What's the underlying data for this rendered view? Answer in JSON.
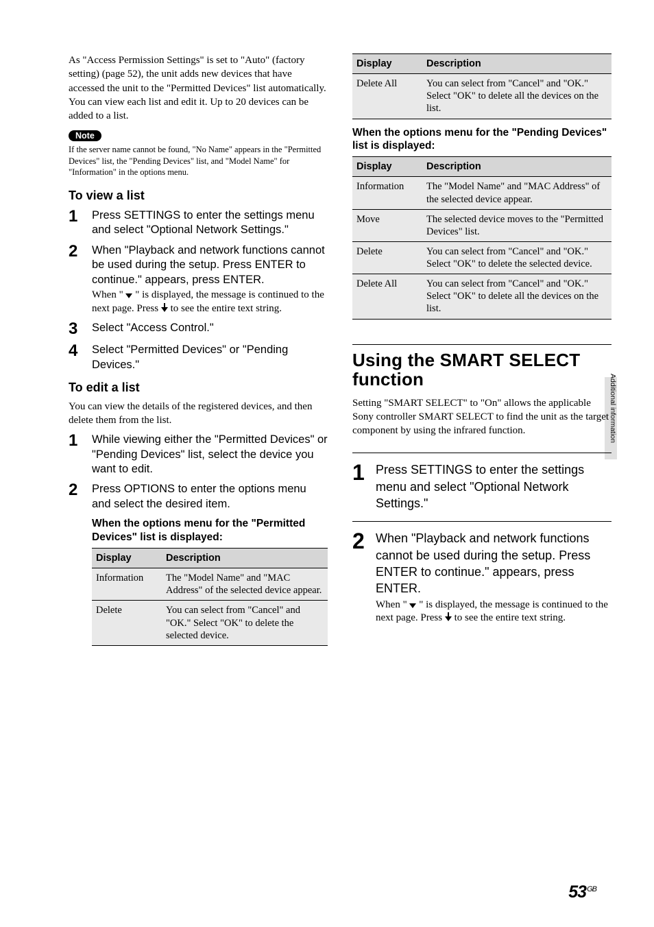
{
  "left": {
    "intro": "As \"Access Permission Settings\" is set to \"Auto\" (factory setting) (page 52), the unit adds new devices that have accessed the unit to the \"Permitted Devices\" list automatically. You can view each list and edit it. Up to 20 devices can be added to a list.",
    "note_badge": "Note",
    "note_text": "If the server name cannot be found, \"No Name\" appears in the \"Permitted Devices\" list, the \"Pending Devices\" list, and \"Model Name\" for \"Information\" in the options menu.",
    "view_heading": "To view a list",
    "view_steps": [
      {
        "num": "1",
        "label": "Press SETTINGS to enter the settings menu and select \"Optional Network Settings.\""
      },
      {
        "num": "2",
        "label": "When \"Playback and network functions cannot be used during the setup. Press ENTER to continue.\" appears, press ENTER.",
        "detail_pre": "When \" ",
        "detail_mid": " \" is displayed, the message is continued to the next page. Press ",
        "detail_post": " to see the entire text string."
      },
      {
        "num": "3",
        "label": "Select \"Access Control.\""
      },
      {
        "num": "4",
        "label": "Select \"Permitted Devices\" or \"Pending Devices.\""
      }
    ],
    "edit_heading": "To edit a list",
    "edit_intro": "You can view the details of the registered devices, and then delete them from the list.",
    "edit_steps": [
      {
        "num": "1",
        "label": "While viewing either the \"Permitted Devices\" or \"Pending Devices\" list, select the device you want to edit."
      },
      {
        "num": "2",
        "label": "Press OPTIONS to enter the options menu and select the desired item."
      }
    ],
    "table1_caption": "When the options menu for the \"Permitted Devices\" list is displayed:",
    "table_headers": {
      "display": "Display",
      "description": "Description"
    },
    "table1_rows": [
      {
        "display": "Information",
        "desc": "The \"Model Name\" and \"MAC Address\" of the selected device appear."
      },
      {
        "display": "Delete",
        "desc": "You can select from \"Cancel\" and \"OK.\" Select \"OK\" to delete the selected device."
      }
    ]
  },
  "right": {
    "table_headers": {
      "display": "Display",
      "description": "Description"
    },
    "table_top_rows": [
      {
        "display": "Delete All",
        "desc": "You can select from \"Cancel\" and \"OK.\" Select \"OK\" to delete all the devices on the list."
      }
    ],
    "table2_caption": "When the options menu for the \"Pending Devices\" list is displayed:",
    "table2_rows": [
      {
        "display": "Information",
        "desc": "The \"Model Name\" and \"MAC Address\" of the selected device appear."
      },
      {
        "display": "Move",
        "desc": "The selected device moves to the \"Permitted Devices\" list."
      },
      {
        "display": "Delete",
        "desc": "You can select from \"Cancel\" and \"OK.\" Select \"OK\" to delete the selected device."
      },
      {
        "display": "Delete All",
        "desc": "You can select from \"Cancel\" and \"OK.\" Select \"OK\" to delete all the devices on the list."
      }
    ],
    "section2_heading": "Using the SMART SELECT function",
    "section2_intro": "Setting \"SMART SELECT\" to \"On\" allows the applicable Sony controller SMART SELECT to find the unit as the target component by using the infrared function.",
    "big_steps": [
      {
        "num": "1",
        "label": "Press SETTINGS to enter the settings menu and select \"Optional Network Settings.\""
      },
      {
        "num": "2",
        "label": "When \"Playback and network functions cannot be used during the setup. Press ENTER to continue.\" appears, press ENTER.",
        "detail_pre": "When \" ",
        "detail_mid": " \" is displayed, the message is continued to the next page. Press ",
        "detail_post": " to see the entire text string."
      }
    ]
  },
  "side_tab": "Additional information",
  "page_number": "53",
  "page_suffix": "GB"
}
